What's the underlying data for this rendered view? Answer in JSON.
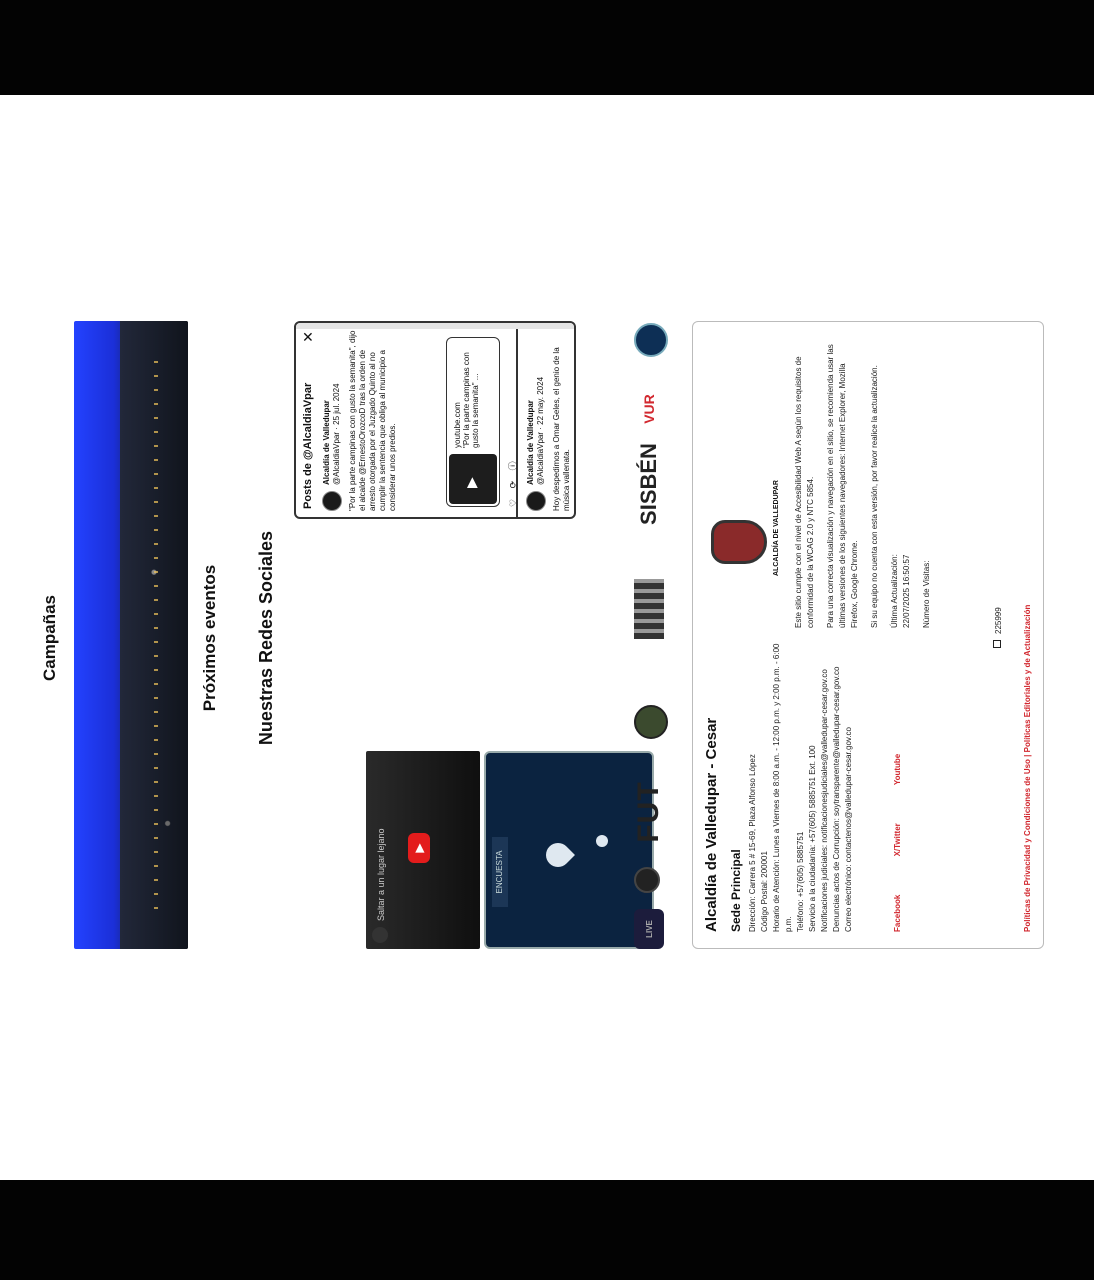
{
  "sections": {
    "campaigns_title": "Campañas",
    "events_title": "Próximos eventos",
    "social_title": "Nuestras Redes Sociales"
  },
  "posts_widget": {
    "header": "Posts de @AlcaldiaVpar",
    "tweet1": {
      "author": "Alcaldía de Valledupar",
      "handle_date": "@AlcaldiaVpar · 25 jul. 2024",
      "text": "\"Por la parte campinas con gusto la semanita\", dijo el alcalde @ErnestoOrozcoD tras la orden de arresto otorgada por el Juzgado Quinto al no cumplir la sentencia que obliga al municipio a considerar unos predios.",
      "card_domain": "youtube.com",
      "card_text": "\"Por la parte campinas con gusto la semanita\" ..."
    },
    "tweet2": {
      "author": "Alcaldía de Valledupar",
      "handle_date": "@AlcaldiaVpar · 22 may. 2024",
      "text": "Hoy despedimos a Omar Geles, el genio de la música vallenata."
    }
  },
  "youtube": {
    "title": "Saltar a un lugar lejano"
  },
  "poll": {
    "label": "ENCUESTA"
  },
  "logos": {
    "live": "LIVE",
    "fut": "FUT",
    "sisben": "SISBÉN",
    "vur": "VUR"
  },
  "footer": {
    "title": "Alcaldía de Valledupar - Cesar",
    "subtitle": "Sede Principal",
    "info": [
      "Dirección: Carrera 5 # 15-69, Plaza Alfonso López",
      "Código Postal: 200001",
      "Horario de Atención: Lunes a Viernes de 8:00 a.m. - 12:00 p.m. y 2:00 p.m. - 6:00 p.m.",
      "Teléfono: +57(605) 5885751",
      "Servicio a la ciudadanía: +57(605) 5885751 Ext. 100",
      "Notificaciones judiciales: notificacionesjudiciales@valledupar-cesar.gov.co",
      "Denuncias actos de Corrupción: soytransparente@valledupar-cesar.gov.co",
      "Correo electrónico: contactenos@valledupar-cesar.gov.co"
    ],
    "social": [
      "Facebook",
      "X/Twitter",
      "Youtube"
    ],
    "crest_label": "ALCALDÍA DE VALLEDUPAR",
    "accessibility": "Este sitio cumple con el nivel de Accesibilidad Web A según los requisitos de conformidad de la WCAG 2.0 y NTC 5854.",
    "browsers": "Para una correcta visualización y navegación en el sitio, se recomienda usar las últimas versiones de los siguientes navegadores: Internet Explorer, Mozilla Firefox, Google Chrome.",
    "update_note": "Si su equipo no cuenta con esta versión, por favor realice la actualización.",
    "last_update_label": "Última Actualización:",
    "last_update_value": "22/07/2025 16:50:57",
    "visits_label": "Número de Visitas:",
    "visits_value": "225999",
    "policies": "Políticas de Privacidad y Condiciones de Uso | Políticas Editoriales y de Actualización"
  }
}
